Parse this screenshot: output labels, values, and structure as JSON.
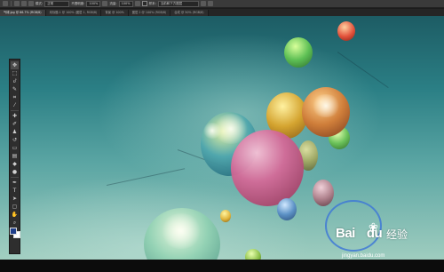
{
  "options_bar": {
    "mode_label": "模式:",
    "mode_value": "正常",
    "opacity_label": "不透明度:",
    "opacity_value": "100%",
    "flow_label": "流量:",
    "flow_value": "100%",
    "sample_label": "样本:",
    "sample_value": "当前和下方图层"
  },
  "tabs": [
    {
      "label": "气球.jpg @ 66.7% (RGB/8)"
    },
    {
      "label": "未标题-1 @ 100% (图层 1, RGB/8)"
    },
    {
      "label": "背景 @ 100%"
    },
    {
      "label": "图层 2 @ 100% (RGB/8)"
    },
    {
      "label": "合成 @ 50% (RGB/8)"
    }
  ],
  "tools": [
    {
      "icon": "move-tool-icon",
      "glyph": "✥"
    },
    {
      "icon": "marquee-tool-icon",
      "glyph": "⬚"
    },
    {
      "icon": "lasso-tool-icon",
      "glyph": "ᦊ"
    },
    {
      "icon": "quick-select-tool-icon",
      "glyph": "✎"
    },
    {
      "icon": "crop-tool-icon",
      "glyph": "⌗"
    },
    {
      "icon": "eyedropper-tool-icon",
      "glyph": "⁄"
    },
    {
      "icon": "healing-brush-tool-icon",
      "glyph": "✚"
    },
    {
      "icon": "brush-tool-icon",
      "glyph": "✐"
    },
    {
      "icon": "clone-stamp-tool-icon",
      "glyph": "♟"
    },
    {
      "icon": "history-brush-tool-icon",
      "glyph": "↺"
    },
    {
      "icon": "eraser-tool-icon",
      "glyph": "▭"
    },
    {
      "icon": "gradient-tool-icon",
      "glyph": "▤"
    },
    {
      "icon": "blur-tool-icon",
      "glyph": "◆"
    },
    {
      "icon": "dodge-tool-icon",
      "glyph": "●"
    },
    {
      "icon": "pen-tool-icon",
      "glyph": "✒"
    },
    {
      "icon": "type-tool-icon",
      "glyph": "T"
    },
    {
      "icon": "path-select-tool-icon",
      "glyph": "➤"
    },
    {
      "icon": "shape-tool-icon",
      "glyph": "▢"
    },
    {
      "icon": "hand-tool-icon",
      "glyph": "✋"
    },
    {
      "icon": "zoom-tool-icon",
      "glyph": "⌕"
    }
  ],
  "colors": {
    "foreground": "#1f3e8a",
    "background": "#ffffff"
  },
  "watermark": {
    "brand": "Bai",
    "brand_suffix": "du",
    "cn": "经验",
    "url": "jingyan.baidu.com"
  }
}
